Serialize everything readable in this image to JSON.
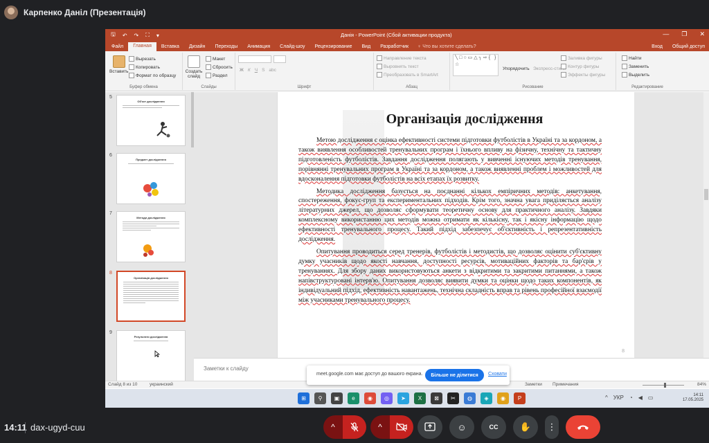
{
  "meet": {
    "presenter_name": "Карпенко Даніл (Презентація)",
    "time": "14:11",
    "meeting_code": "dax-ugyd-cuu",
    "controls": {
      "mic_options": "^",
      "mic": "🎤",
      "camera_options": "^",
      "camera": "📷",
      "present": "⇧",
      "emoji": "☺",
      "captions": "CC",
      "raise_hand": "✋",
      "more": "⋮",
      "leave": "☎"
    }
  },
  "powerpoint": {
    "window_title": "Данія - PowerPoint (Сбой активации продукта)",
    "qat": {
      "save": "🖫",
      "undo": "↶",
      "redo": "↷",
      "present": "⛶",
      "more": "▾"
    },
    "window_controls": {
      "minimize": "—",
      "restore": "❐",
      "close": "✕"
    },
    "tabs": [
      "Файл",
      "Главная",
      "Вставка",
      "Дизайн",
      "Переходы",
      "Анимация",
      "Слайд-шоу",
      "Рецензирование",
      "Вид",
      "Разработчик"
    ],
    "active_tab": "Главная",
    "tell_me": "♀ Что вы хотите сделать?",
    "sign_in": "Вход",
    "share": "Общий доступ",
    "ribbon": {
      "clipboard": {
        "paste": "Вставить",
        "cut": "Вырезать",
        "copy": "Копировать",
        "format_painter": "Формат по образцу",
        "group_label": "Буфер обмена"
      },
      "slides": {
        "new_slide": "Создать слайд",
        "layout": "Макет",
        "reset": "Сбросить",
        "section": "Раздел",
        "group_label": "Слайды"
      },
      "font": {
        "bold": "Ж",
        "italic": "К",
        "underline": "Ч",
        "strikethrough": "S",
        "shadow": "abc",
        "group_label": "Шрифт"
      },
      "paragraph": {
        "text_direction": "Направление текста",
        "align_text": "Выровнять текст",
        "smartart": "Преобразовать в SmartArt",
        "group_label": "Абзац"
      },
      "drawing": {
        "shapes": "╲□○▭△╮⇨{ }☆",
        "arrange": "Упорядочить",
        "quick_styles": "Экспресс-стили",
        "fill": "Заливка фигуры",
        "outline": "Контур фигуры",
        "effects": "Эффекты фигуры",
        "group_label": "Рисование"
      },
      "editing": {
        "find": "Найти",
        "replace": "Заменить",
        "select": "Выделить",
        "group_label": "Редактирование"
      }
    },
    "thumbnails": [
      {
        "num": "5",
        "title": "Об'єкт дослідження"
      },
      {
        "num": "6",
        "title": "Предмет дослідження"
      },
      {
        "num": "7",
        "title": "Методи дослідження"
      },
      {
        "num": "8",
        "title": "Організація дослідження"
      },
      {
        "num": "9",
        "title": "Результати дослідження"
      }
    ],
    "selected_thumbnail": "8",
    "slide": {
      "title": "Організація дослідження",
      "paragraphs": [
        "Метою дослідження є оцінка ефективності системи підготовки футболістів в Україні та за кордоном, а також виявлення особливостей тренувальних програм і їхнього впливу на фізичну, технічну та тактичну підготовленість футболістів. Завдання дослідження полягають у вивченні існуючих методів тренування, порівнянні тренувальних програм в Україні та за кордоном, а також виявленні проблем і можливостей для вдосконалення підготовки футболістів на всіх етапах їх розвитку.",
        "Методика дослідження базується на поєднанні кількох емпіричних методів: анкетування, спостереження, фокус-груп та експериментальних підходів. Крім того, значна увага приділяється аналізу літературних джерел, що дозволяє сформувати теоретичну основу для практичного аналізу. Завдяки комплексному використанню цих методів можна отримати як кількісну, так і якісну інформацію щодо ефективності тренувального процесу. Такий підхід забезпечує об'єктивність і репрезентативність дослідження.",
        "Опитування проводиться серед тренерів, футболістів і методистів, що дозволяє оцінити суб'єктивну думку учасників щодо якості навчання, доступності ресурсів, мотиваційних факторів та бар'єрів у тренуваннях. Для збору даних використовуються анкети з відкритими та закритими питаннями, а також напівструктуровані інтерв'ю. Опитування дозволяє виявити думки та оцінки щодо таких компонентів, як індивідуальний підхід, ефективність навантажень, технічна складність вправ та рівень професійної взаємодії між учасниками тренувального процесу."
      ],
      "number": "8"
    },
    "notes_placeholder": "Заметки к слайду",
    "status": {
      "slide_counter": "Слайд 8 из 10",
      "language": "украинский",
      "notes": "Заметки",
      "comments": "Примечания",
      "zoom": "84%"
    }
  },
  "screen_share_banner": {
    "message": "meet.google.com має доступ до вашого екрана.",
    "stop_button": "Більше не ділитися",
    "hide_link": "Сховати"
  },
  "windows_taskbar": {
    "time": "14:11",
    "date": "17.05.2025",
    "keyboard": "УКР",
    "apps": [
      {
        "name": "windows-icon",
        "glyph": "⊞",
        "color": "#1e6fd9"
      },
      {
        "name": "search-icon",
        "glyph": "⚲",
        "color": "#555555"
      },
      {
        "name": "task-view-icon",
        "glyph": "▣",
        "color": "#444444"
      },
      {
        "name": "edge-icon",
        "glyph": "e",
        "color": "#1a8f6a"
      },
      {
        "name": "chrome-icon",
        "glyph": "◉",
        "color": "#dd4b39"
      },
      {
        "name": "viber-icon",
        "glyph": "◎",
        "color": "#7360f2"
      },
      {
        "name": "telegram-icon",
        "glyph": "➤",
        "color": "#2aa3df"
      },
      {
        "name": "excel-icon",
        "glyph": "X",
        "color": "#1d7044"
      },
      {
        "name": "store-icon",
        "glyph": "⊠",
        "color": "#3a3a3a"
      },
      {
        "name": "capcut-icon",
        "glyph": "✂",
        "color": "#222222"
      },
      {
        "name": "app-icon",
        "glyph": "◍",
        "color": "#3a7bd5"
      },
      {
        "name": "photos-icon",
        "glyph": "◈",
        "color": "#1aa6b7"
      },
      {
        "name": "chrome-profile-icon",
        "glyph": "◉",
        "color": "#e0a11b"
      },
      {
        "name": "powerpoint-icon",
        "glyph": "P",
        "color": "#c43e1c"
      }
    ]
  },
  "colors": {
    "ppt_accent": "#b7472a",
    "meet_bg": "#202124",
    "meet_red": "#ea4335",
    "share_blue": "#1a73e8"
  }
}
